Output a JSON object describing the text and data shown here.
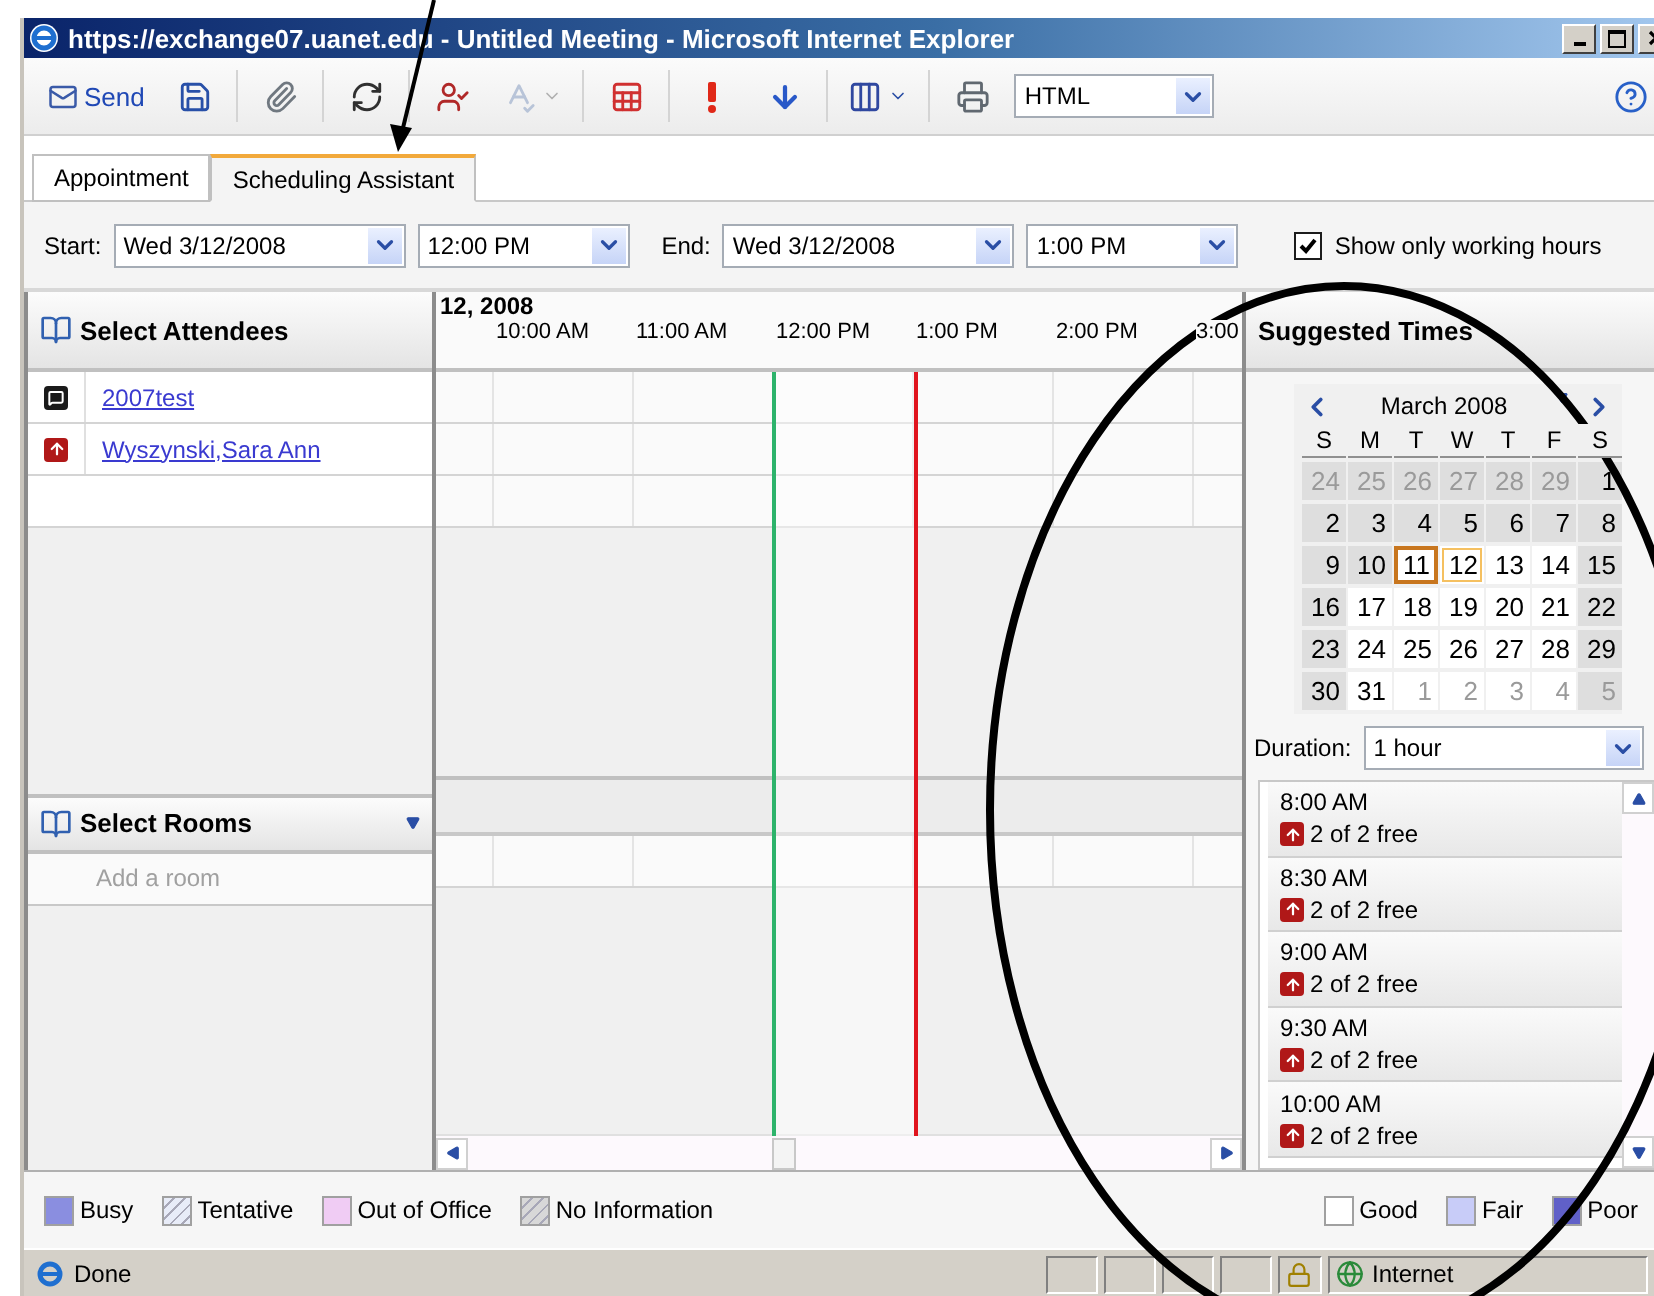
{
  "window": {
    "title": "https://exchange07.uanet.edu - Untitled Meeting - Microsoft Internet Explorer"
  },
  "toolbar": {
    "send": "Send",
    "format": "HTML"
  },
  "tabs": [
    {
      "label": "Appointment",
      "selected": false
    },
    {
      "label": "Scheduling Assistant",
      "selected": true
    }
  ],
  "times": {
    "start_label": "Start:",
    "start_date": "Wed 3/12/2008",
    "start_time": "12:00 PM",
    "end_label": "End:",
    "end_date": "Wed 3/12/2008",
    "end_time": "1:00 PM",
    "working_hours": {
      "label": "Show only working hours",
      "checked": true
    }
  },
  "attendees": {
    "title": "Select Attendees",
    "rows": [
      {
        "name": "2007test",
        "kind": "organizer"
      },
      {
        "name": "Wyszynski,Sara Ann",
        "kind": "required"
      }
    ]
  },
  "rooms": {
    "title": "Select Rooms",
    "placeholder": "Add a room"
  },
  "timeline": {
    "date": "12, 2008",
    "hours": [
      "10:00 AM",
      "11:00 AM",
      "12:00 PM",
      "1:00 PM",
      "2:00 PM",
      "3:00"
    ]
  },
  "suggested": {
    "title": "Suggested Times",
    "calendar": {
      "month": "March 2008",
      "weekdays": [
        "S",
        "M",
        "T",
        "W",
        "T",
        "F",
        "S"
      ],
      "weeks": [
        [
          {
            "label": "24",
            "other_month": true,
            "shaded": true,
            "today": false,
            "selected": false
          },
          {
            "label": "25",
            "other_month": true,
            "shaded": true,
            "today": false,
            "selected": false
          },
          {
            "label": "26",
            "other_month": true,
            "shaded": true,
            "today": false,
            "selected": false
          },
          {
            "label": "27",
            "other_month": true,
            "shaded": true,
            "today": false,
            "selected": false
          },
          {
            "label": "28",
            "other_month": true,
            "shaded": true,
            "today": false,
            "selected": false
          },
          {
            "label": "29",
            "other_month": true,
            "shaded": true,
            "today": false,
            "selected": false
          },
          {
            "label": "1",
            "other_month": false,
            "shaded": true,
            "today": false,
            "selected": false
          }
        ],
        [
          {
            "label": "2",
            "other_month": false,
            "shaded": true,
            "today": false,
            "selected": false
          },
          {
            "label": "3",
            "other_month": false,
            "shaded": true,
            "today": false,
            "selected": false
          },
          {
            "label": "4",
            "other_month": false,
            "shaded": true,
            "today": false,
            "selected": false
          },
          {
            "label": "5",
            "other_month": false,
            "shaded": true,
            "today": false,
            "selected": false
          },
          {
            "label": "6",
            "other_month": false,
            "shaded": true,
            "today": false,
            "selected": false
          },
          {
            "label": "7",
            "other_month": false,
            "shaded": true,
            "today": false,
            "selected": false
          },
          {
            "label": "8",
            "other_month": false,
            "shaded": true,
            "today": false,
            "selected": false
          }
        ],
        [
          {
            "label": "9",
            "other_month": false,
            "shaded": true,
            "today": false,
            "selected": false
          },
          {
            "label": "10",
            "other_month": false,
            "shaded": true,
            "today": false,
            "selected": false
          },
          {
            "label": "11",
            "other_month": false,
            "shaded": false,
            "today": true,
            "selected": false
          },
          {
            "label": "12",
            "other_month": false,
            "shaded": false,
            "today": false,
            "selected": true
          },
          {
            "label": "13",
            "other_month": false,
            "shaded": false,
            "today": false,
            "selected": false
          },
          {
            "label": "14",
            "other_month": false,
            "shaded": false,
            "today": false,
            "selected": false
          },
          {
            "label": "15",
            "other_month": false,
            "shaded": true,
            "today": false,
            "selected": false
          }
        ],
        [
          {
            "label": "16",
            "other_month": false,
            "shaded": true,
            "today": false,
            "selected": false
          },
          {
            "label": "17",
            "other_month": false,
            "shaded": false,
            "today": false,
            "selected": false
          },
          {
            "label": "18",
            "other_month": false,
            "shaded": false,
            "today": false,
            "selected": false
          },
          {
            "label": "19",
            "other_month": false,
            "shaded": false,
            "today": false,
            "selected": false
          },
          {
            "label": "20",
            "other_month": false,
            "shaded": false,
            "today": false,
            "selected": false
          },
          {
            "label": "21",
            "other_month": false,
            "shaded": false,
            "today": false,
            "selected": false
          },
          {
            "label": "22",
            "other_month": false,
            "shaded": true,
            "today": false,
            "selected": false
          }
        ],
        [
          {
            "label": "23",
            "other_month": false,
            "shaded": true,
            "today": false,
            "selected": false
          },
          {
            "label": "24",
            "other_month": false,
            "shaded": false,
            "today": false,
            "selected": false
          },
          {
            "label": "25",
            "other_month": false,
            "shaded": false,
            "today": false,
            "selected": false
          },
          {
            "label": "26",
            "other_month": false,
            "shaded": false,
            "today": false,
            "selected": false
          },
          {
            "label": "27",
            "other_month": false,
            "shaded": false,
            "today": false,
            "selected": false
          },
          {
            "label": "28",
            "other_month": false,
            "shaded": false,
            "today": false,
            "selected": false
          },
          {
            "label": "29",
            "other_month": false,
            "shaded": true,
            "today": false,
            "selected": false
          }
        ],
        [
          {
            "label": "30",
            "other_month": false,
            "shaded": true,
            "today": false,
            "selected": false
          },
          {
            "label": "31",
            "other_month": false,
            "shaded": false,
            "today": false,
            "selected": false
          },
          {
            "label": "1",
            "other_month": true,
            "shaded": false,
            "today": false,
            "selected": false
          },
          {
            "label": "2",
            "other_month": true,
            "shaded": false,
            "today": false,
            "selected": false
          },
          {
            "label": "3",
            "other_month": true,
            "shaded": false,
            "today": false,
            "selected": false
          },
          {
            "label": "4",
            "other_month": true,
            "shaded": false,
            "today": false,
            "selected": false
          },
          {
            "label": "5",
            "other_month": true,
            "shaded": true,
            "today": false,
            "selected": false
          }
        ]
      ]
    },
    "duration_label": "Duration:",
    "duration": "1 hour",
    "slots": [
      {
        "time": "8:00 AM",
        "availability": "2 of 2 free"
      },
      {
        "time": "8:30 AM",
        "availability": "2 of 2 free"
      },
      {
        "time": "9:00 AM",
        "availability": "2 of 2 free"
      },
      {
        "time": "9:30 AM",
        "availability": "2 of 2 free"
      },
      {
        "time": "10:00 AM",
        "availability": "2 of 2 free"
      }
    ]
  },
  "legend": [
    {
      "label": "Busy",
      "kind": "solid",
      "color": "#8a8ee0"
    },
    {
      "label": "Tentative",
      "kind": "hatch",
      "color": "#e8ecf8"
    },
    {
      "label": "Out of Office",
      "kind": "solid",
      "color": "#f0ccf4"
    },
    {
      "label": "No Information",
      "kind": "hatch",
      "color": "#d8d8d8"
    }
  ],
  "quality": [
    {
      "label": "Good",
      "color": "#ffffff"
    },
    {
      "label": "Fair",
      "color": "#c8ccf8"
    },
    {
      "label": "Poor",
      "color": "#6060c8"
    }
  ],
  "status_bar": {
    "text": "Done",
    "zone": "Internet"
  }
}
